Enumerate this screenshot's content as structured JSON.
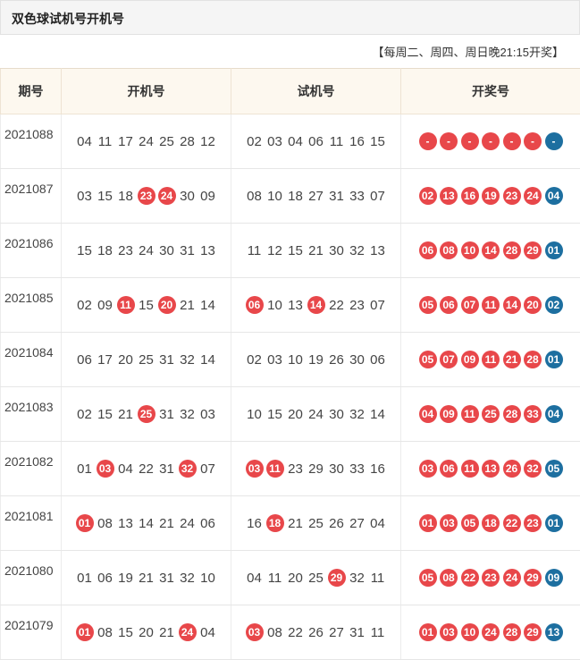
{
  "title": "双色球试机号开机号",
  "note": "【每周二、周四、周日晚21:15开奖】",
  "headers": [
    "期号",
    "开机号",
    "试机号",
    "开奖号"
  ],
  "colors": {
    "red_ball": "#e8474a",
    "blue_ball": "#1d6fa0",
    "header_bg": "#fdf8ef"
  },
  "rows": [
    {
      "issue": "2021088",
      "open": [
        {
          "v": "04",
          "h": false
        },
        {
          "v": "11",
          "h": false
        },
        {
          "v": "17",
          "h": false
        },
        {
          "v": "24",
          "h": false
        },
        {
          "v": "25",
          "h": false
        },
        {
          "v": "28",
          "h": false
        },
        {
          "v": "12",
          "h": false
        }
      ],
      "trial": [
        {
          "v": "02",
          "h": false
        },
        {
          "v": "03",
          "h": false
        },
        {
          "v": "04",
          "h": false
        },
        {
          "v": "06",
          "h": false
        },
        {
          "v": "11",
          "h": false
        },
        {
          "v": "16",
          "h": false
        },
        {
          "v": "15",
          "h": false
        }
      ],
      "draw": [
        "-",
        "-",
        "-",
        "-",
        "-",
        "-",
        "-"
      ]
    },
    {
      "issue": "2021087",
      "open": [
        {
          "v": "03",
          "h": false
        },
        {
          "v": "15",
          "h": false
        },
        {
          "v": "18",
          "h": false
        },
        {
          "v": "23",
          "h": true
        },
        {
          "v": "24",
          "h": true
        },
        {
          "v": "30",
          "h": false
        },
        {
          "v": "09",
          "h": false
        }
      ],
      "trial": [
        {
          "v": "08",
          "h": false
        },
        {
          "v": "10",
          "h": false
        },
        {
          "v": "18",
          "h": false
        },
        {
          "v": "27",
          "h": false
        },
        {
          "v": "31",
          "h": false
        },
        {
          "v": "33",
          "h": false
        },
        {
          "v": "07",
          "h": false
        }
      ],
      "draw": [
        "02",
        "13",
        "16",
        "19",
        "23",
        "24",
        "04"
      ]
    },
    {
      "issue": "2021086",
      "open": [
        {
          "v": "15",
          "h": false
        },
        {
          "v": "18",
          "h": false
        },
        {
          "v": "23",
          "h": false
        },
        {
          "v": "24",
          "h": false
        },
        {
          "v": "30",
          "h": false
        },
        {
          "v": "31",
          "h": false
        },
        {
          "v": "13",
          "h": false
        }
      ],
      "trial": [
        {
          "v": "11",
          "h": false
        },
        {
          "v": "12",
          "h": false
        },
        {
          "v": "15",
          "h": false
        },
        {
          "v": "21",
          "h": false
        },
        {
          "v": "30",
          "h": false
        },
        {
          "v": "32",
          "h": false
        },
        {
          "v": "13",
          "h": false
        }
      ],
      "draw": [
        "06",
        "08",
        "10",
        "14",
        "28",
        "29",
        "01"
      ]
    },
    {
      "issue": "2021085",
      "open": [
        {
          "v": "02",
          "h": false
        },
        {
          "v": "09",
          "h": false
        },
        {
          "v": "11",
          "h": true
        },
        {
          "v": "15",
          "h": false
        },
        {
          "v": "20",
          "h": true
        },
        {
          "v": "21",
          "h": false
        },
        {
          "v": "14",
          "h": false
        }
      ],
      "trial": [
        {
          "v": "06",
          "h": true
        },
        {
          "v": "10",
          "h": false
        },
        {
          "v": "13",
          "h": false
        },
        {
          "v": "14",
          "h": true
        },
        {
          "v": "22",
          "h": false
        },
        {
          "v": "23",
          "h": false
        },
        {
          "v": "07",
          "h": false
        }
      ],
      "draw": [
        "05",
        "06",
        "07",
        "11",
        "14",
        "20",
        "02"
      ]
    },
    {
      "issue": "2021084",
      "open": [
        {
          "v": "06",
          "h": false
        },
        {
          "v": "17",
          "h": false
        },
        {
          "v": "20",
          "h": false
        },
        {
          "v": "25",
          "h": false
        },
        {
          "v": "31",
          "h": false
        },
        {
          "v": "32",
          "h": false
        },
        {
          "v": "14",
          "h": false
        }
      ],
      "trial": [
        {
          "v": "02",
          "h": false
        },
        {
          "v": "03",
          "h": false
        },
        {
          "v": "10",
          "h": false
        },
        {
          "v": "19",
          "h": false
        },
        {
          "v": "26",
          "h": false
        },
        {
          "v": "30",
          "h": false
        },
        {
          "v": "06",
          "h": false
        }
      ],
      "draw": [
        "05",
        "07",
        "09",
        "11",
        "21",
        "28",
        "01"
      ]
    },
    {
      "issue": "2021083",
      "open": [
        {
          "v": "02",
          "h": false
        },
        {
          "v": "15",
          "h": false
        },
        {
          "v": "21",
          "h": false
        },
        {
          "v": "25",
          "h": true
        },
        {
          "v": "31",
          "h": false
        },
        {
          "v": "32",
          "h": false
        },
        {
          "v": "03",
          "h": false
        }
      ],
      "trial": [
        {
          "v": "10",
          "h": false
        },
        {
          "v": "15",
          "h": false
        },
        {
          "v": "20",
          "h": false
        },
        {
          "v": "24",
          "h": false
        },
        {
          "v": "30",
          "h": false
        },
        {
          "v": "32",
          "h": false
        },
        {
          "v": "14",
          "h": false
        }
      ],
      "draw": [
        "04",
        "09",
        "11",
        "25",
        "28",
        "33",
        "04"
      ]
    },
    {
      "issue": "2021082",
      "open": [
        {
          "v": "01",
          "h": false
        },
        {
          "v": "03",
          "h": true
        },
        {
          "v": "04",
          "h": false
        },
        {
          "v": "22",
          "h": false
        },
        {
          "v": "31",
          "h": false
        },
        {
          "v": "32",
          "h": true
        },
        {
          "v": "07",
          "h": false
        }
      ],
      "trial": [
        {
          "v": "03",
          "h": true
        },
        {
          "v": "11",
          "h": true
        },
        {
          "v": "23",
          "h": false
        },
        {
          "v": "29",
          "h": false
        },
        {
          "v": "30",
          "h": false
        },
        {
          "v": "33",
          "h": false
        },
        {
          "v": "16",
          "h": false
        }
      ],
      "draw": [
        "03",
        "06",
        "11",
        "13",
        "26",
        "32",
        "05"
      ]
    },
    {
      "issue": "2021081",
      "open": [
        {
          "v": "01",
          "h": true
        },
        {
          "v": "08",
          "h": false
        },
        {
          "v": "13",
          "h": false
        },
        {
          "v": "14",
          "h": false
        },
        {
          "v": "21",
          "h": false
        },
        {
          "v": "24",
          "h": false
        },
        {
          "v": "06",
          "h": false
        }
      ],
      "trial": [
        {
          "v": "16",
          "h": false
        },
        {
          "v": "18",
          "h": true
        },
        {
          "v": "21",
          "h": false
        },
        {
          "v": "25",
          "h": false
        },
        {
          "v": "26",
          "h": false
        },
        {
          "v": "27",
          "h": false
        },
        {
          "v": "04",
          "h": false
        }
      ],
      "draw": [
        "01",
        "03",
        "05",
        "18",
        "22",
        "23",
        "01"
      ]
    },
    {
      "issue": "2021080",
      "open": [
        {
          "v": "01",
          "h": false
        },
        {
          "v": "06",
          "h": false
        },
        {
          "v": "19",
          "h": false
        },
        {
          "v": "21",
          "h": false
        },
        {
          "v": "31",
          "h": false
        },
        {
          "v": "32",
          "h": false
        },
        {
          "v": "10",
          "h": false
        }
      ],
      "trial": [
        {
          "v": "04",
          "h": false
        },
        {
          "v": "11",
          "h": false
        },
        {
          "v": "20",
          "h": false
        },
        {
          "v": "25",
          "h": false
        },
        {
          "v": "29",
          "h": true
        },
        {
          "v": "32",
          "h": false
        },
        {
          "v": "11",
          "h": false
        }
      ],
      "draw": [
        "05",
        "08",
        "22",
        "23",
        "24",
        "29",
        "09"
      ]
    },
    {
      "issue": "2021079",
      "open": [
        {
          "v": "01",
          "h": true
        },
        {
          "v": "08",
          "h": false
        },
        {
          "v": "15",
          "h": false
        },
        {
          "v": "20",
          "h": false
        },
        {
          "v": "21",
          "h": false
        },
        {
          "v": "24",
          "h": true
        },
        {
          "v": "04",
          "h": false
        }
      ],
      "trial": [
        {
          "v": "03",
          "h": true
        },
        {
          "v": "08",
          "h": false
        },
        {
          "v": "22",
          "h": false
        },
        {
          "v": "26",
          "h": false
        },
        {
          "v": "27",
          "h": false
        },
        {
          "v": "31",
          "h": false
        },
        {
          "v": "11",
          "h": false
        }
      ],
      "draw": [
        "01",
        "03",
        "10",
        "24",
        "28",
        "29",
        "13"
      ]
    }
  ]
}
